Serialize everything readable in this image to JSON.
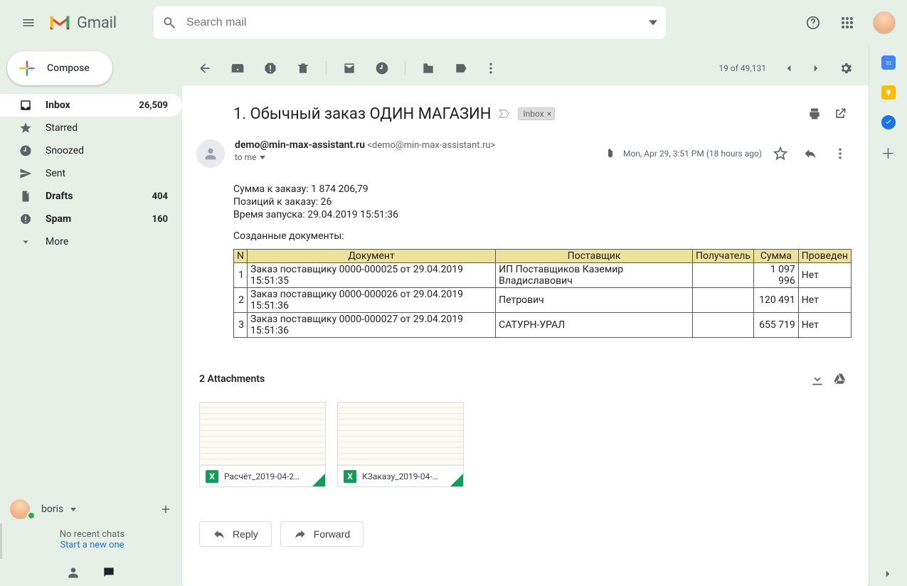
{
  "brand": "Gmail",
  "search": {
    "placeholder": "Search mail"
  },
  "compose_label": "Compose",
  "sidebar": {
    "items": [
      {
        "label": "Inbox",
        "count": "26,509"
      },
      {
        "label": "Starred"
      },
      {
        "label": "Snoozed"
      },
      {
        "label": "Sent"
      },
      {
        "label": "Drafts",
        "count": "404"
      },
      {
        "label": "Spam",
        "count": "160"
      },
      {
        "label": "More"
      }
    ]
  },
  "hangouts": {
    "name": "boris",
    "no_chats": "No recent chats",
    "start": "Start a new one",
    "plus_label": "+"
  },
  "toolbar": {
    "position": "19 of 49,131"
  },
  "message": {
    "subject": "1. Обычный заказ ОДИН МАГАЗИН",
    "label_chip": "Inbox",
    "from_name": "demo@min-max-assistant.ru",
    "from_addr": "<demo@min-max-assistant.ru>",
    "to_line": "to me",
    "date": "Mon, Apr 29, 3:51 PM (18 hours ago)",
    "summary": {
      "line1": "Сумма к заказу: 1 874 206,79",
      "line2": "Позиций к заказу: 26",
      "line3": "Время запуска: 29.04.2019 15:51:36"
    },
    "table_caption": "Созданные документы:",
    "table": {
      "headers": [
        "N",
        "Документ",
        "Поставщик",
        "Получатель",
        "Сумма",
        "Проведен"
      ],
      "rows": [
        {
          "n": "1",
          "doc": "Заказ поставщику 0000-000025 от 29.04.2019 15:51:35",
          "supplier": "ИП Поставщиков Каземир Владиславович",
          "receiver": "",
          "sum": "1 097 996",
          "posted": "Нет"
        },
        {
          "n": "2",
          "doc": "Заказ поставщику 0000-000026 от 29.04.2019 15:51:36",
          "supplier": "Петрович",
          "receiver": "",
          "sum": "120 491",
          "posted": "Нет"
        },
        {
          "n": "3",
          "doc": "Заказ поставщику 0000-000027 от 29.04.2019 15:51:36",
          "supplier": "САТУРН-УРАЛ",
          "receiver": "",
          "sum": "655 719",
          "posted": "Нет"
        }
      ]
    },
    "attachments_title": "2 Attachments",
    "attachments": [
      {
        "name": "Расчёт_2019-04-2…"
      },
      {
        "name": "КЗаказу_2019-04-…"
      }
    ],
    "reply": "Reply",
    "forward": "Forward"
  }
}
